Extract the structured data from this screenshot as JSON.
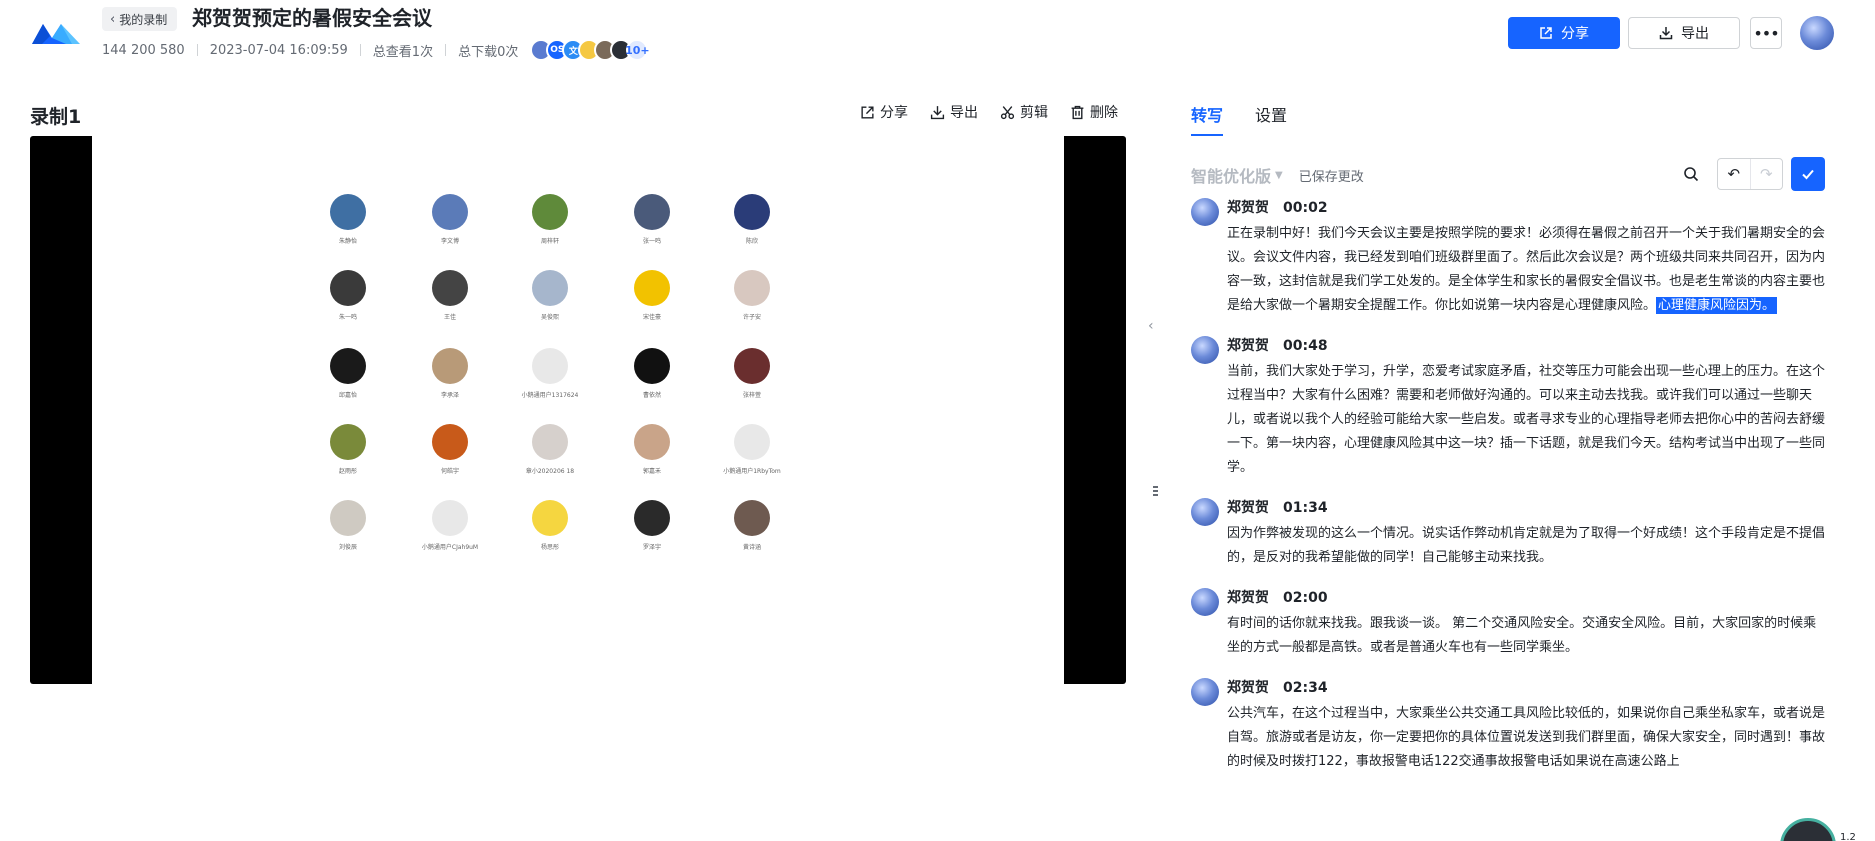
{
  "header": {
    "back_label": "我的录制",
    "title": "郑贺贺预定的暑假安全会议",
    "meeting_id": "144 200 580",
    "datetime": "2023-07-04 16:09:59",
    "views": "总查看1次",
    "downloads": "总下载0次",
    "participants": [
      {
        "text": "",
        "color": "#5a7bd0"
      },
      {
        "text": "OS",
        "color": "#1664ff"
      },
      {
        "text": "文",
        "color": "#2b8cf5"
      },
      {
        "text": "",
        "color": "#f5c842"
      },
      {
        "text": "",
        "color": "#7a6a5a"
      },
      {
        "text": "",
        "color": "#2b2f36"
      }
    ],
    "participants_more": "10+",
    "share_label": "分享",
    "export_label": "导出"
  },
  "left": {
    "recording_title": "录制1",
    "toolbar": {
      "share": "分享",
      "export": "导出",
      "edit": "剪辑",
      "delete": "删除"
    },
    "video_grid": [
      {
        "name": "朱静怡",
        "color": "#3f6fa3"
      },
      {
        "name": "李文博",
        "color": "#5b7bb8"
      },
      {
        "name": "周梓轩",
        "color": "#5f8a3a"
      },
      {
        "name": "张一鸣",
        "color": "#4a5a7a"
      },
      {
        "name": "陈欣",
        "color": "#2a3c78"
      },
      {
        "name": "朱一鸣",
        "color": "#3a3a3a"
      },
      {
        "name": "王佳",
        "color": "#444444"
      },
      {
        "name": "吴俊熙",
        "color": "#a6b6cc"
      },
      {
        "name": "宋佳豪",
        "color": "#f2c200"
      },
      {
        "name": "许子安",
        "color": "#d8c8c0"
      },
      {
        "name": "邱嘉怡",
        "color": "#1a1a1a"
      },
      {
        "name": "李承泽",
        "color": "#b89a78"
      },
      {
        "name": "小鹅通用户1317624",
        "color": "#e8e8e8"
      },
      {
        "name": "曹依然",
        "color": "#111111"
      },
      {
        "name": "张梓萱",
        "color": "#6a2e2e"
      },
      {
        "name": "赵雨彤",
        "color": "#7a8a3a"
      },
      {
        "name": "何皓宇",
        "color": "#c85a1a"
      },
      {
        "name": "章小2020206 18",
        "color": "#d6d0cc"
      },
      {
        "name": "郭嘉禾",
        "color": "#c9a489"
      },
      {
        "name": "小鹅通用户1RbyTom",
        "color": "#e8e8e8"
      },
      {
        "name": "刘俊辰",
        "color": "#cfcac2"
      },
      {
        "name": "小鹅通用户CJah9uM",
        "color": "#e8e8e8"
      },
      {
        "name": "杨思彤",
        "color": "#f5d640"
      },
      {
        "name": "罗泽宇",
        "color": "#2a2a2a"
      },
      {
        "name": "黄诗涵",
        "color": "#6e5a50"
      }
    ]
  },
  "right": {
    "tabs": [
      "转写",
      "设置"
    ],
    "version_label": "智能优化版",
    "saved_label": "已保存更改",
    "segments": [
      {
        "speaker": "郑贺贺",
        "time": "00:02",
        "text": "正在录制中好！我们今天会议主要是按照学院的要求！必须得在暑假之前召开一个关于我们暑期安全的会议。会议文件内容，我已经发到咱们班级群里面了。然后此次会议是？两个班级共同来共同召开，因为内容一致，这封信就是我们学工处发的。是全体学生和家长的暑假安全倡议书。也是老生常谈的内容主要也是给大家做一个暑期安全提醒工作。你比如说第一块内容是心理健康风险。",
        "highlight": "心理健康风险因为。"
      },
      {
        "speaker": "郑贺贺",
        "time": "00:48",
        "text": "当前，我们大家处于学习，升学，恋爱考试家庭矛盾，社交等压力可能会出现一些心理上的压力。在这个过程当中？大家有什么困难？需要和老师做好沟通的。可以来主动去找我。或许我们可以通过一些聊天儿，或者说以我个人的经验可能给大家一些启发。或者寻求专业的心理指导老师去把你心中的苦闷去舒缓一下。第一块内容，心理健康风险其中这一块？插一下话题，就是我们今天。结构考试当中出现了一些同学。",
        "highlight": ""
      },
      {
        "speaker": "郑贺贺",
        "time": "01:34",
        "text": "因为作弊被发现的这么一个情况。说实话作弊动机肯定就是为了取得一个好成绩！这个手段肯定是不提倡的，是反对的我希望能做的同学！自己能够主动来找我。",
        "highlight": ""
      },
      {
        "speaker": "郑贺贺",
        "time": "02:00",
        "text": "有时间的话你就来找我。跟我谈一谈。 第二个交通风险安全。交通安全风险。目前，大家回家的时候乘坐的方式一般都是高铁。或者是普通火车也有一些同学乘坐。",
        "highlight": ""
      },
      {
        "speaker": "郑贺贺",
        "time": "02:34",
        "text": "公共汽车，在这个过程当中，大家乘坐公共交通工具风险比较低的，如果说你自己乘坐私家车，或者说是自驾。旅游或者是访友，你一定要把你的具体位置说发送到我们群里面，确保大家安全，同时遇到！事故的时候及时拨打122，事故报警电话122交通事故报警电话如果说在高速公路上",
        "highlight": ""
      }
    ],
    "float_label": "1.2"
  },
  "colors": {
    "primary": "#1664ff",
    "text": "#1f2329",
    "muted": "#646a73"
  }
}
